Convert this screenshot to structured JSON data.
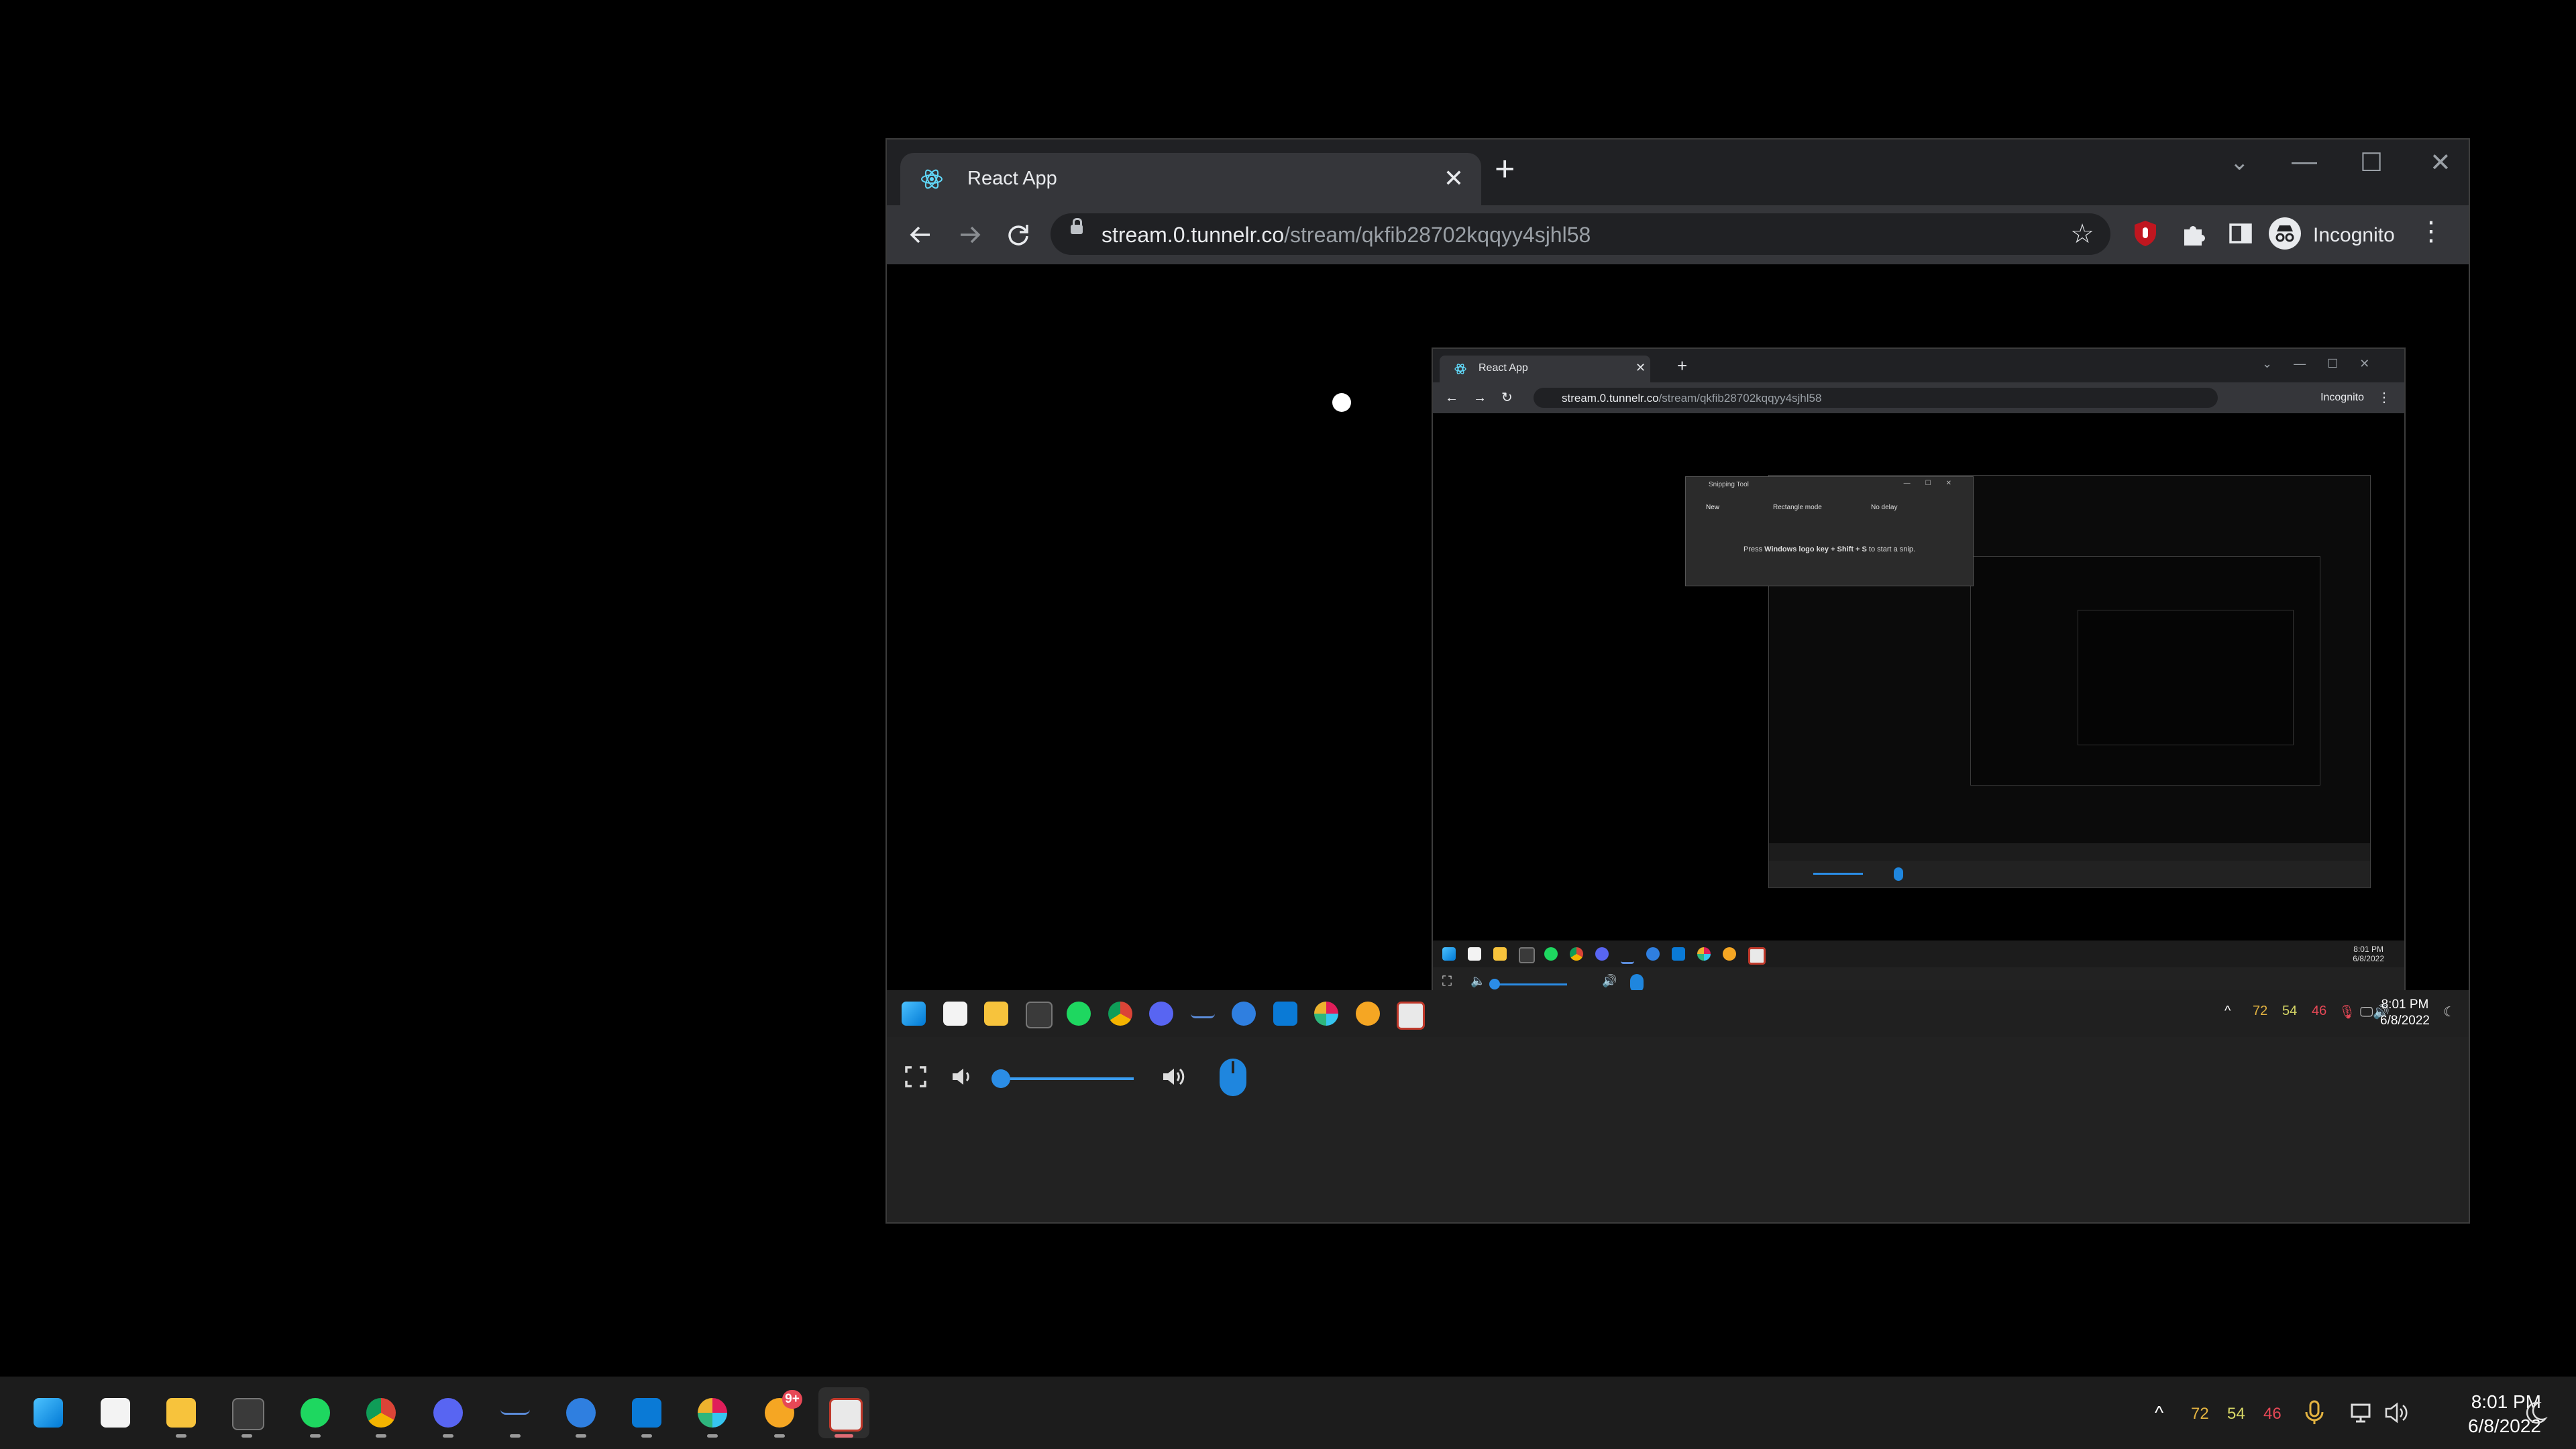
{
  "browser": {
    "tab_title": "React App",
    "url_host": "stream.0.tunnelr.co",
    "url_path": "/stream/qkfib28702kqqyy4sjhl58",
    "profile_label": "Incognito",
    "new_tab_symbol": "+",
    "tab_close_symbol": "✕",
    "window_controls": [
      "⌄",
      "—",
      "☐",
      "✕"
    ]
  },
  "nested_browser": {
    "tab_title": "React App",
    "url_host": "stream.0.tunnelr.co",
    "url_path": "/stream/qkfib28702kqqyy4sjhl58",
    "profile_label": "Incognito",
    "clock_time": "8:01 PM",
    "clock_date": "6/8/2022"
  },
  "snipping_tool": {
    "title": "Snipping Tool",
    "new_label": "New",
    "mode_label": "Rectangle mode",
    "delay_label": "No delay",
    "hint_prefix": "Press ",
    "hint_bold": "Windows logo key + Shift + S",
    "hint_suffix": " to start a snip."
  },
  "remote_taskbar": {
    "tray_numbers": [
      "72",
      "54",
      "46"
    ],
    "clock_time": "8:01 PM",
    "clock_date": "6/8/2022"
  },
  "stream_controls": {
    "volume_level": 0.0,
    "icons": [
      "fullscreen-icon",
      "volume-down-icon",
      "volume-up-icon",
      "mouse-icon"
    ]
  },
  "taskbar": {
    "apps": [
      "start",
      "microsoft-store",
      "file-explorer",
      "terminal",
      "spotify",
      "chrome",
      "discord",
      "minimized-app",
      "app-scripting",
      "vscode",
      "slack",
      "chat-app",
      "snipping-tool"
    ],
    "chat_badge": "9+",
    "tray_numbers": [
      "72",
      "54",
      "46"
    ],
    "clock_time": "8:01 PM",
    "clock_date": "6/8/2022"
  },
  "colors": {
    "accent": "#2b8de6",
    "cpu_temp": "#e3b341",
    "gpu_temp": "#d7d766",
    "hot_temp": "#e74856"
  }
}
